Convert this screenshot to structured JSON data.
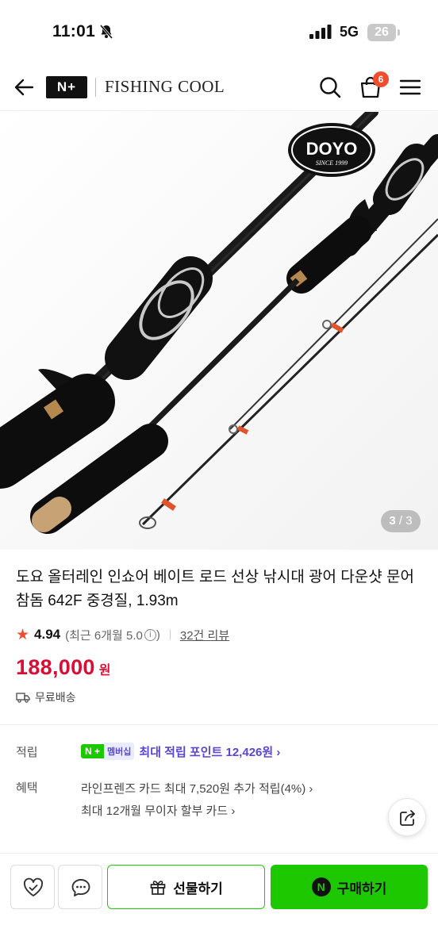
{
  "status_bar": {
    "time": "11:01",
    "network": "5G",
    "battery": "26"
  },
  "header": {
    "brand_badge": "N+",
    "brand_name": "FISHING COOL",
    "cart_count": "6",
    "icons": [
      "back-arrow-icon",
      "search-icon",
      "shopping-bag-icon",
      "hamburger-menu-icon"
    ]
  },
  "product_image": {
    "logo_text": "DOYO",
    "logo_subtext": "SINCE 1999",
    "counter_current": "3",
    "counter_total": " / 3"
  },
  "product": {
    "title": "도요 올터레인 인쇼어 베이트 로드 선상 낚시대 광어 다운샷 문어 참돔 642F 중경질, 1.93m",
    "rating": "4.94",
    "rating_recent": "(최근 6개월 5.0",
    "rating_recent_close": ")",
    "reviews": "32건 리뷰",
    "price": "188,000",
    "price_unit": "원",
    "shipping": "무료배송"
  },
  "benefits": {
    "points_label": "적립",
    "membership_badge_n": "N +",
    "membership_badge_text": "멤버십",
    "membership_text": "최대 적립 포인트 12,426원 ›",
    "benefit_label": "혜택",
    "benefit_lines": [
      "라인프렌즈 카드 최대 7,520원 추가 적립(4%) ›",
      "최대 12개월 무이자 할부 카드 ›"
    ]
  },
  "bottom_bar": {
    "gift_label": "선물하기",
    "buy_label": "구매하기",
    "npay_mark": "N"
  },
  "colors": {
    "accent_green": "#1ec800",
    "price_red": "#d90e37",
    "badge_orange": "#f04d2d",
    "membership_purple": "#5b45d6"
  }
}
